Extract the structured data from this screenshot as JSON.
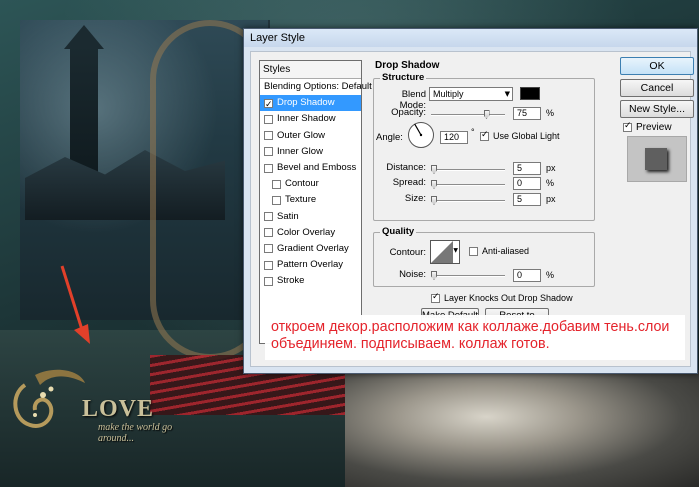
{
  "window": {
    "title": "Layer Style",
    "styles_header": "Styles",
    "styles_items": [
      {
        "label": "Blending Options: Default",
        "checkbox": false,
        "checked": false,
        "selected": false,
        "indent": false
      },
      {
        "label": "Drop Shadow",
        "checkbox": true,
        "checked": true,
        "selected": true,
        "indent": false
      },
      {
        "label": "Inner Shadow",
        "checkbox": true,
        "checked": false,
        "selected": false,
        "indent": false
      },
      {
        "label": "Outer Glow",
        "checkbox": true,
        "checked": false,
        "selected": false,
        "indent": false
      },
      {
        "label": "Inner Glow",
        "checkbox": true,
        "checked": false,
        "selected": false,
        "indent": false
      },
      {
        "label": "Bevel and Emboss",
        "checkbox": true,
        "checked": false,
        "selected": false,
        "indent": false
      },
      {
        "label": "Contour",
        "checkbox": true,
        "checked": false,
        "selected": false,
        "indent": true
      },
      {
        "label": "Texture",
        "checkbox": true,
        "checked": false,
        "selected": false,
        "indent": true
      },
      {
        "label": "Satin",
        "checkbox": true,
        "checked": false,
        "selected": false,
        "indent": false
      },
      {
        "label": "Color Overlay",
        "checkbox": true,
        "checked": false,
        "selected": false,
        "indent": false
      },
      {
        "label": "Gradient Overlay",
        "checkbox": true,
        "checked": false,
        "selected": false,
        "indent": false
      },
      {
        "label": "Pattern Overlay",
        "checkbox": true,
        "checked": false,
        "selected": false,
        "indent": false
      },
      {
        "label": "Stroke",
        "checkbox": true,
        "checked": false,
        "selected": false,
        "indent": false
      }
    ],
    "panel_title": "Drop Shadow",
    "structure": {
      "label": "Structure",
      "blend_mode_label": "Blend Mode:",
      "blend_mode_value": "Multiply",
      "shadow_color": "#000000",
      "opacity_label": "Opacity:",
      "opacity_value": "75",
      "opacity_unit": "%",
      "opacity_fraction": 0.75,
      "angle_label": "Angle:",
      "angle_value": "120",
      "angle_unit": "°",
      "use_global_light_label": "Use Global Light",
      "use_global_light": true,
      "distance_label": "Distance:",
      "distance_value": "5",
      "distance_unit": "px",
      "spread_label": "Spread:",
      "spread_value": "0",
      "spread_unit": "%",
      "size_label": "Size:",
      "size_value": "5",
      "size_unit": "px"
    },
    "quality": {
      "label": "Quality",
      "contour_label": "Contour:",
      "anti_aliased_label": "Anti-aliased",
      "anti_aliased": false,
      "noise_label": "Noise:",
      "noise_value": "0",
      "noise_unit": "%"
    },
    "knocks_out_label": "Layer Knocks Out Drop Shadow",
    "knocks_out": true,
    "make_default_label": "Make Default",
    "reset_default_label": "Reset to Default",
    "ok_label": "OK",
    "cancel_label": "Cancel",
    "new_style_label": "New Style...",
    "preview_label": "Preview",
    "preview_checked": true
  },
  "caption": {
    "text": "откроем декор.расположим как коллаже.добавим тень.слои объединяем. подписываем. коллаж готов."
  },
  "artwork": {
    "logo_text": "LOVE",
    "logo_tagline": "make the world go around..."
  },
  "colors": {
    "caption_text": "#e4232b",
    "selected_row": "#3399ff",
    "arrow": "#e2402a"
  }
}
